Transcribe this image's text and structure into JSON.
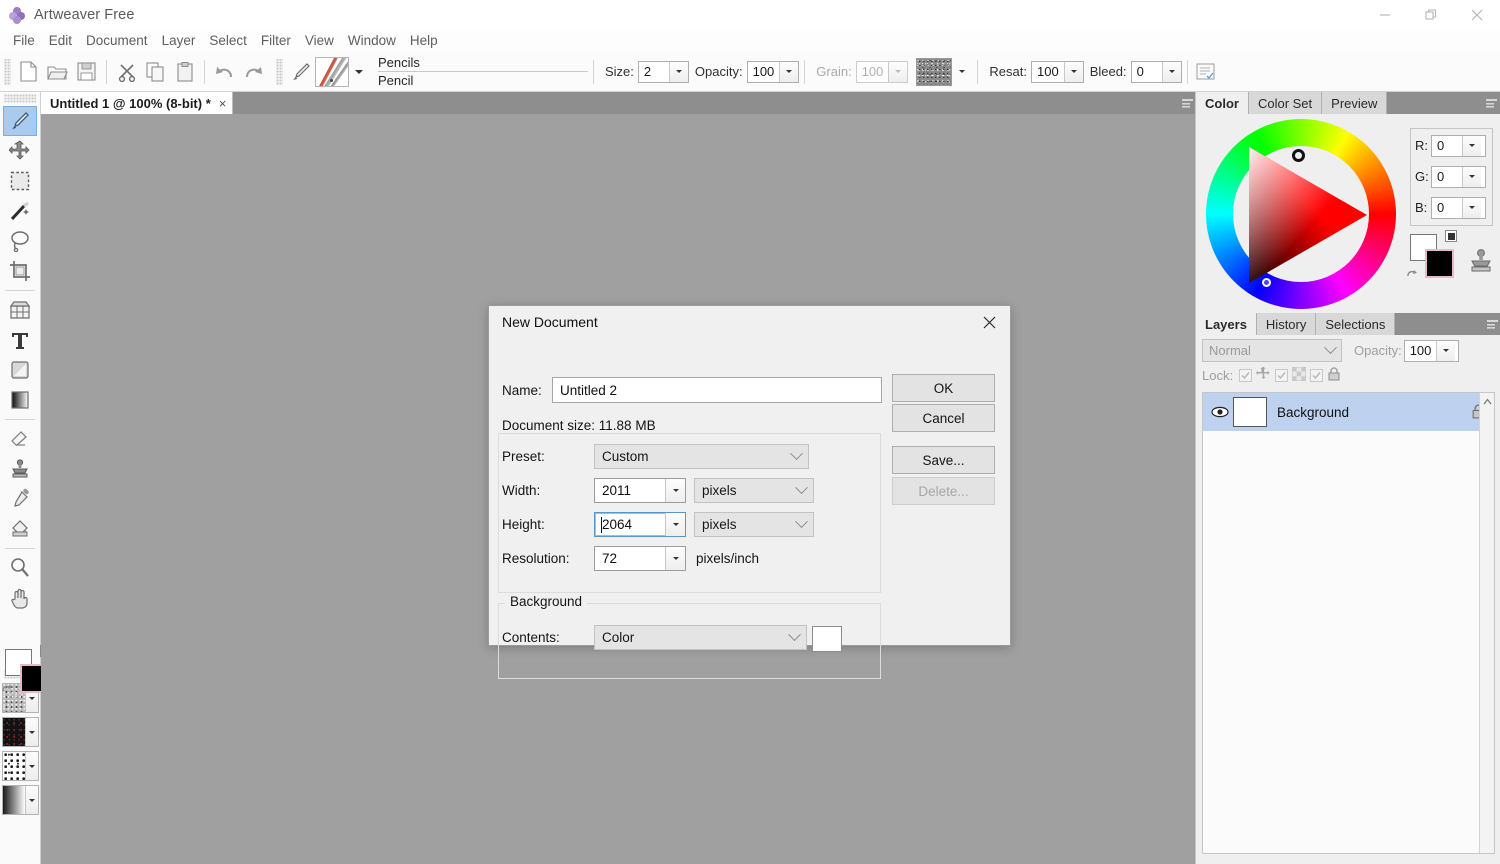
{
  "window": {
    "app_title": "Artweaver Free",
    "app_icon": "flower-icon",
    "controls": [
      {
        "name": "minimize",
        "glyph": "minimize-icon"
      },
      {
        "name": "restore",
        "glyph": "restore-icon"
      },
      {
        "name": "close",
        "glyph": "close-icon"
      }
    ]
  },
  "menubar": {
    "items": [
      "File",
      "Edit",
      "Document",
      "Layer",
      "Select",
      "Filter",
      "View",
      "Window",
      "Help"
    ]
  },
  "toolbar": {
    "buttons": [
      {
        "name": "new-document",
        "icon": "page-icon"
      },
      {
        "name": "open-document",
        "icon": "folder-icon"
      },
      {
        "name": "save-document",
        "icon": "floppy-icon"
      },
      {
        "name": "cut",
        "icon": "scissors-icon"
      },
      {
        "name": "copy",
        "icon": "copy-icon"
      },
      {
        "name": "paste",
        "icon": "clipboard-icon"
      },
      {
        "name": "undo",
        "icon": "undo-arrow-icon"
      },
      {
        "name": "redo",
        "icon": "redo-arrow-icon"
      },
      {
        "name": "brush-tool",
        "icon": "brush-icon"
      }
    ],
    "brush_category": "Pencils",
    "brush_variant": "Pencil",
    "fields": [
      {
        "label": "Size:",
        "value": "2",
        "enabled": true
      },
      {
        "label": "Opacity:",
        "value": "100",
        "enabled": true
      },
      {
        "label": "Grain:",
        "value": "100",
        "enabled": false
      },
      {
        "label": "Resat:",
        "value": "100",
        "enabled": true
      },
      {
        "label": "Bleed:",
        "value": "0",
        "enabled": true
      }
    ],
    "grain_swatch": "noise-texture-swatch",
    "options_button": "brush-options-icon"
  },
  "toolbox": {
    "tools": [
      {
        "name": "paintbrush-tool",
        "icon": "paintbrush-icon",
        "active": true
      },
      {
        "name": "move-tool",
        "icon": "move-arrows-icon",
        "active": false
      },
      {
        "name": "rectangular-marquee-tool",
        "icon": "dashed-square-icon",
        "active": false
      },
      {
        "name": "magic-wand-tool",
        "icon": "magic-wand-icon",
        "active": false
      },
      {
        "name": "lasso-tool",
        "icon": "lasso-icon",
        "active": false
      },
      {
        "name": "crop-tool",
        "icon": "crop-icon",
        "active": false
      },
      {
        "name": "perspective-tool",
        "icon": "grid-perspective-icon",
        "active": false
      },
      {
        "name": "text-tool",
        "icon": "text-t-icon",
        "active": false
      },
      {
        "name": "shape-tool",
        "icon": "rounded-square-icon",
        "active": false
      },
      {
        "name": "gradient-tool",
        "icon": "gradient-square-icon",
        "active": false
      },
      {
        "name": "eraser-tool",
        "icon": "eraser-icon",
        "active": false
      },
      {
        "name": "clone-stamp-tool",
        "icon": "stamp-icon",
        "active": false
      },
      {
        "name": "eyedropper-tool",
        "icon": "eyedropper-icon",
        "active": false
      },
      {
        "name": "paint-bucket-tool",
        "icon": "paint-bucket-icon",
        "active": false
      },
      {
        "name": "zoom-tool",
        "icon": "magnifier-icon",
        "active": false
      },
      {
        "name": "hand-tool",
        "icon": "hand-icon",
        "active": false
      }
    ],
    "color_chips": {
      "foreground": "#000000",
      "background": "#ffffff",
      "swap_icon": "swap-colors-icon",
      "default_icon": "default-colors-icon"
    },
    "selectors": [
      {
        "name": "paper-texture-selector",
        "icon": "paper-grain-swatch"
      },
      {
        "name": "pattern-selector",
        "icon": "dark-pattern-swatch"
      },
      {
        "name": "nozzle-selector",
        "icon": "scatter-swatch"
      },
      {
        "name": "gradient-selector",
        "icon": "gradient-swatch"
      }
    ]
  },
  "document": {
    "tab_title": "Untitled 1 @ 100% (8-bit) *",
    "close_glyph": "×",
    "tabbar_menu_icon": "panel-menu-icon",
    "canvas_color": "#a0a0a0"
  },
  "color_panel": {
    "tabs": [
      {
        "label": "Color",
        "active": true
      },
      {
        "label": "Color Set",
        "active": false
      },
      {
        "label": "Preview",
        "active": false
      }
    ],
    "menu_icon": "panel-menu-icon",
    "wheel_icon": "hsv-color-wheel",
    "channels": [
      {
        "label": "R:",
        "value": "0"
      },
      {
        "label": "G:",
        "value": "0"
      },
      {
        "label": "B:",
        "value": "0"
      }
    ],
    "foreground": "#000000",
    "background": "#ffffff",
    "stamp_icon": "clone-stamp-icon"
  },
  "layers_panel": {
    "tabs": [
      {
        "label": "Layers",
        "active": true
      },
      {
        "label": "History",
        "active": false
      },
      {
        "label": "Selections",
        "active": false
      }
    ],
    "menu_icon": "panel-menu-icon",
    "blend_mode": "Normal",
    "opacity_label": "Opacity:",
    "opacity_value": "100",
    "lock_label": "Lock:",
    "lock_toggles": [
      {
        "name": "lock-transparency",
        "icon": "move-arrows-icon",
        "checked": true
      },
      {
        "name": "lock-pixels",
        "icon": "checker-icon",
        "checked": true
      },
      {
        "name": "lock-position",
        "icon": "padlock-icon",
        "checked": true
      }
    ],
    "layers": [
      {
        "name": "Background",
        "visible": true,
        "locked": true,
        "selected": true,
        "visibility_icon": "eye-icon",
        "lock_icon": "padlock-icon",
        "thumbnail_color": "#ffffff"
      }
    ],
    "scroll_up_icon": "chevron-up-icon"
  },
  "dialog": {
    "title": "New Document",
    "close_icon": "close-icon",
    "name_label": "Name:",
    "name_value": "Untitled 2",
    "document_size_text": "Document size: 11.88 MB",
    "rows": [
      {
        "label": "Preset:",
        "type": "combo",
        "value": "Custom"
      },
      {
        "label": "Width:",
        "type": "spin-unit",
        "value": "2011",
        "unit": "pixels",
        "focused": false
      },
      {
        "label": "Height:",
        "type": "spin-unit",
        "value": "2064",
        "unit": "pixels",
        "focused": true
      },
      {
        "label": "Resolution:",
        "type": "spin-text",
        "value": "72",
        "unit": "pixels/inch"
      }
    ],
    "background_legend": "Background",
    "contents_label": "Contents:",
    "contents_value": "Color",
    "contents_color": "#ffffff",
    "buttons": [
      {
        "label": "OK",
        "name": "ok-button",
        "enabled": true
      },
      {
        "label": "Cancel",
        "name": "cancel-button",
        "enabled": true
      },
      {
        "label": "Save...",
        "name": "save-preset-button",
        "enabled": true
      },
      {
        "label": "Delete...",
        "name": "delete-preset-button",
        "enabled": false
      }
    ]
  }
}
